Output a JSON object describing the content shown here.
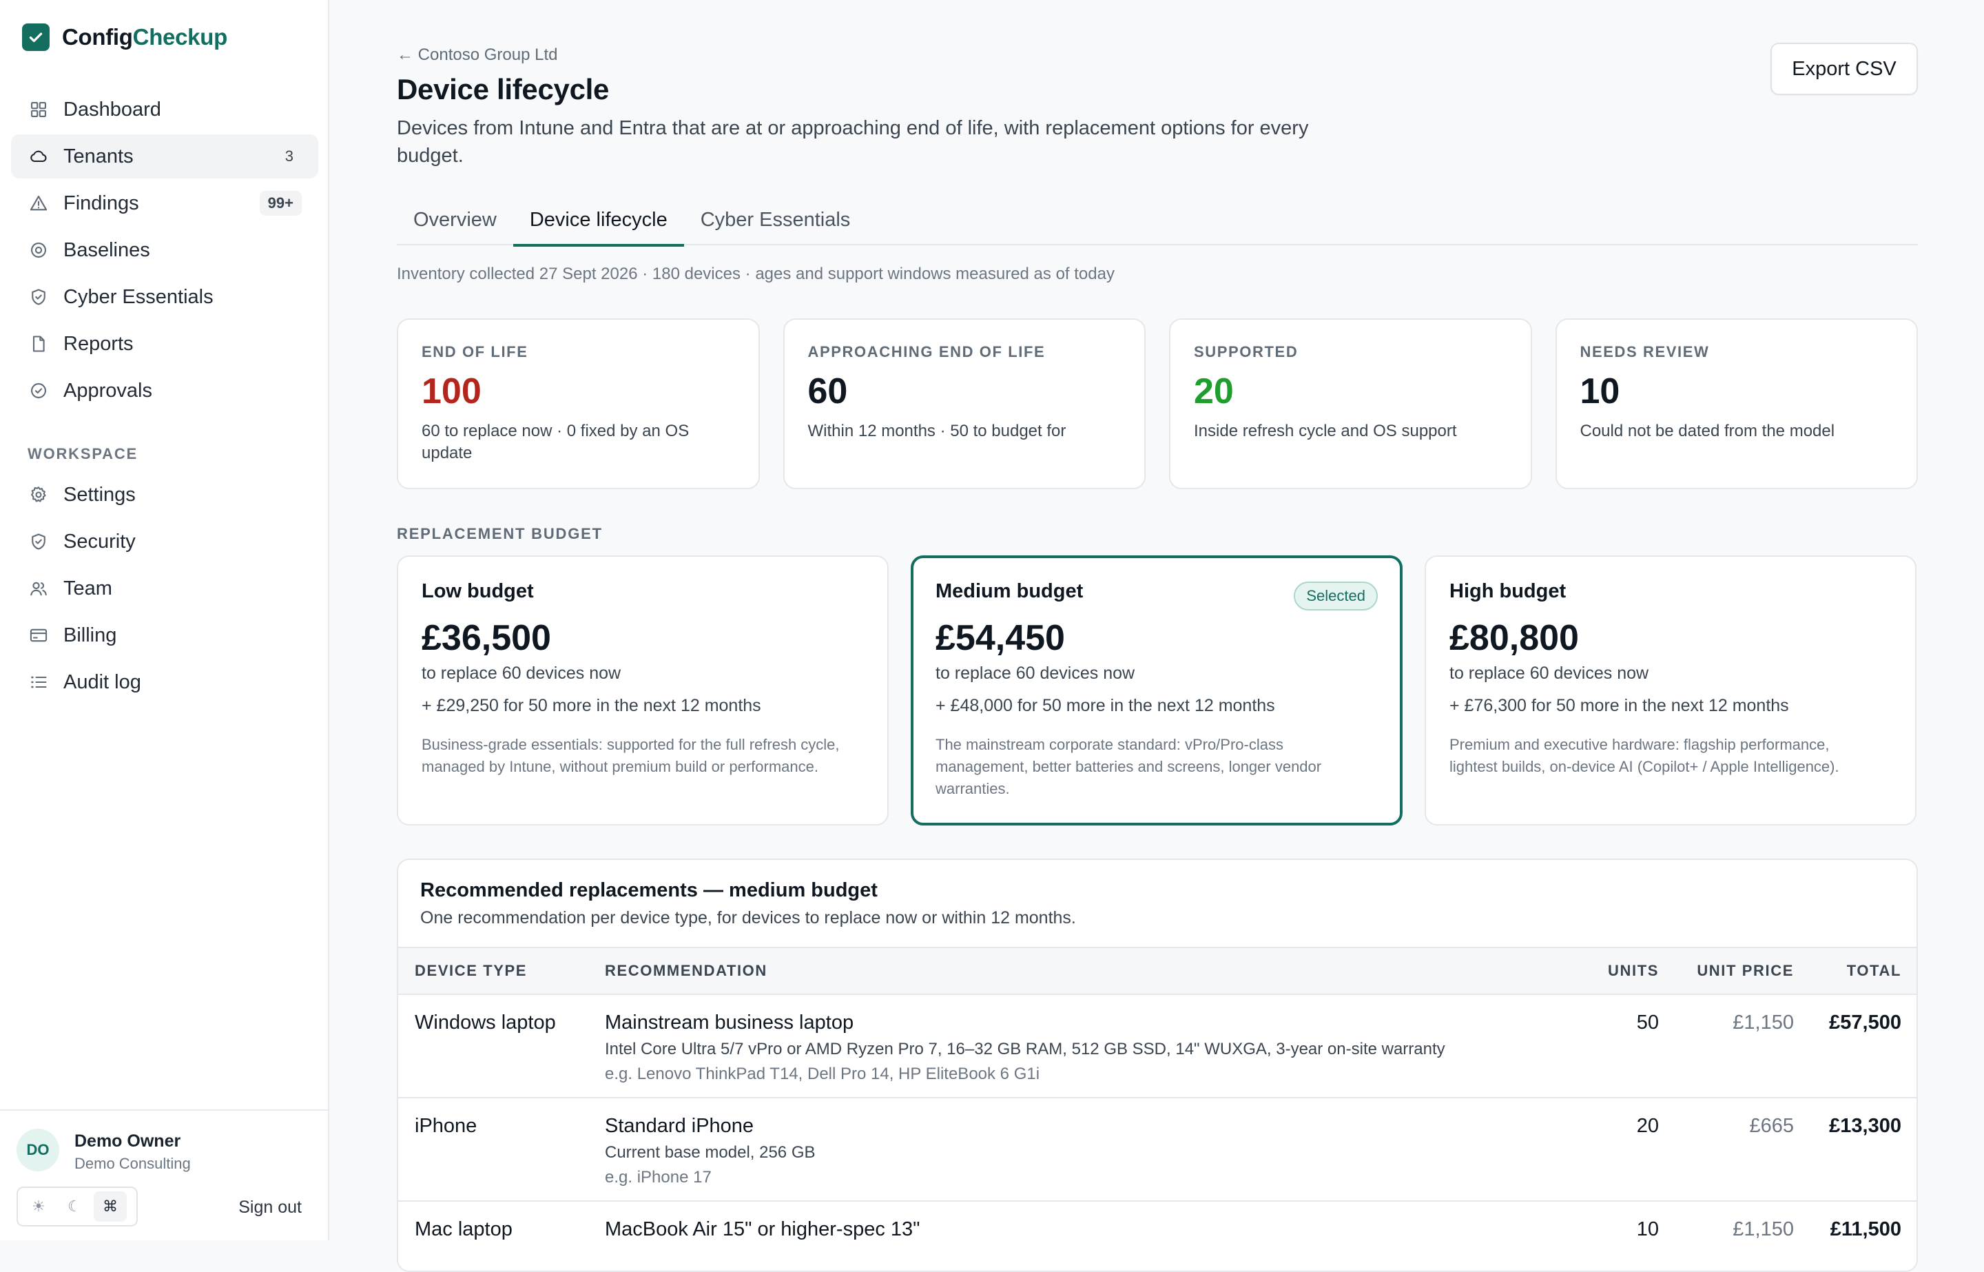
{
  "brand": {
    "part1": "Config",
    "part2": "Checkup",
    "accent": "#136e60"
  },
  "sidebar": {
    "items": [
      {
        "label": "Dashboard",
        "icon": "grid-icon",
        "badge": ""
      },
      {
        "label": "Tenants",
        "icon": "cloud-icon",
        "badge": "3"
      },
      {
        "label": "Findings",
        "icon": "warning-triangle-icon",
        "badge": "99+"
      },
      {
        "label": "Baselines",
        "icon": "target-icon",
        "badge": ""
      },
      {
        "label": "Cyber Essentials",
        "icon": "shield-check-icon",
        "badge": ""
      },
      {
        "label": "Reports",
        "icon": "document-icon",
        "badge": ""
      },
      {
        "label": "Approvals",
        "icon": "check-circle-icon",
        "badge": ""
      }
    ],
    "workspace_label": "WORKSPACE",
    "workspace_items": [
      {
        "label": "Settings",
        "icon": "gear-icon"
      },
      {
        "label": "Security",
        "icon": "shield-icon"
      },
      {
        "label": "Team",
        "icon": "users-icon"
      },
      {
        "label": "Billing",
        "icon": "credit-card-icon"
      },
      {
        "label": "Audit log",
        "icon": "list-icon"
      }
    ],
    "user": {
      "initials": "DO",
      "name": "Demo Owner",
      "org": "Demo Consulting"
    },
    "theme": {
      "light": "☀",
      "dark": "☾",
      "system": "⌘"
    },
    "sign_out": "Sign out"
  },
  "header": {
    "back": "← Contoso Group Ltd",
    "title": "Device lifecycle",
    "description": "Devices from Intune and Entra that are at or approaching end of life, with replacement options for every budget.",
    "export": "Export CSV"
  },
  "tabs": [
    "Overview",
    "Device lifecycle",
    "Cyber Essentials"
  ],
  "inventory_note": "Inventory collected 27 Sept 2026 · 180 devices · ages and support windows measured as of today",
  "stats": [
    {
      "label": "END OF LIFE",
      "value": "100",
      "sub": "60 to replace now · 0 fixed by an OS update",
      "color": "#b3261e"
    },
    {
      "label": "APPROACHING END OF LIFE",
      "value": "60",
      "sub": "Within 12 months · 50 to budget for",
      "color": "#0f1720"
    },
    {
      "label": "SUPPORTED",
      "value": "20",
      "sub": "Inside refresh cycle and OS support",
      "color": "#1f9d2e"
    },
    {
      "label": "NEEDS REVIEW",
      "value": "10",
      "sub": "Could not be dated from the model",
      "color": "#0f1720"
    }
  ],
  "budget_label": "REPLACEMENT BUDGET",
  "budgets": [
    {
      "name": "Low budget",
      "amount": "£36,500",
      "line1": "to replace 60 devices now",
      "line2": "+ £29,250 for 50 more in the next 12 months",
      "desc": "Business-grade essentials: supported for the full refresh cycle, managed by Intune, without premium build or performance.",
      "badge": ""
    },
    {
      "name": "Medium budget",
      "amount": "£54,450",
      "line1": "to replace 60 devices now",
      "line2": "+ £48,000 for 50 more in the next 12 months",
      "desc": "The mainstream corporate standard: vPro/Pro-class management, better batteries and screens, longer vendor warranties.",
      "badge": "Selected"
    },
    {
      "name": "High budget",
      "amount": "£80,800",
      "line1": "to replace 60 devices now",
      "line2": "+ £76,300 for 50 more in the next 12 months",
      "desc": "Premium and executive hardware: flagship performance, lightest builds, on-device AI (Copilot+ / Apple Intelligence).",
      "badge": ""
    }
  ],
  "recommendations": {
    "title": "Recommended replacements — medium budget",
    "subtitle": "One recommendation per device type, for devices to replace now or within 12 months.",
    "columns": {
      "type": "DEVICE TYPE",
      "rec": "RECOMMENDATION",
      "units": "UNITS",
      "price": "UNIT PRICE",
      "total": "TOTAL"
    },
    "rows": [
      {
        "type": "Windows laptop",
        "name": "Mainstream business laptop",
        "spec": "Intel Core Ultra 5/7 vPro or AMD Ryzen Pro 7, 16–32 GB RAM, 512 GB SSD, 14\" WUXGA, 3-year on-site warranty",
        "eg": "e.g. Lenovo ThinkPad T14, Dell Pro 14, HP EliteBook 6 G1i",
        "units": "50",
        "price": "£1,150",
        "total": "£57,500"
      },
      {
        "type": "iPhone",
        "name": "Standard iPhone",
        "spec": "Current base model, 256 GB",
        "eg": "e.g. iPhone 17",
        "units": "20",
        "price": "£665",
        "total": "£13,300"
      },
      {
        "type": "Mac laptop",
        "name": "MacBook Air 15\" or higher-spec 13\"",
        "spec": "",
        "eg": "",
        "units": "10",
        "price": "£1,150",
        "total": "£11,500"
      }
    ]
  }
}
